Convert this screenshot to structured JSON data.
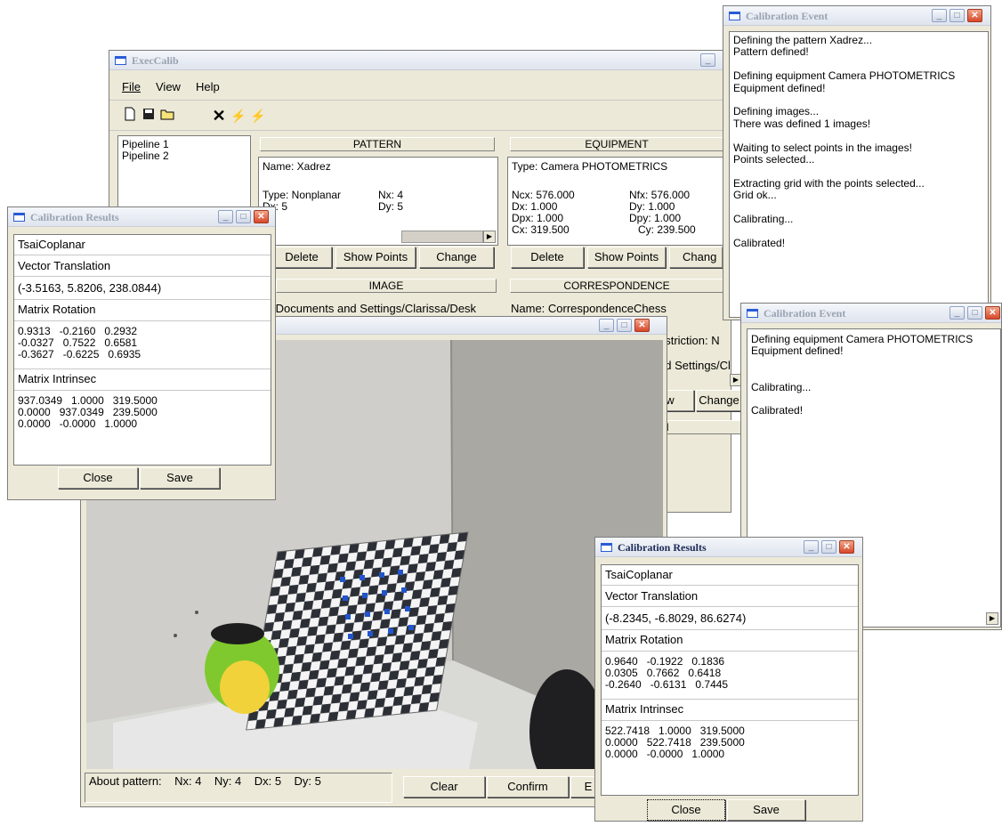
{
  "main": {
    "title": "ExecCalib",
    "menu": [
      "File",
      "View",
      "Help"
    ],
    "pipelines": [
      "Pipeline 1",
      "Pipeline 2"
    ],
    "pattern": {
      "header": "PATTERN",
      "name": "Name: Xadrez",
      "type": "Type: Nonplanar",
      "nx": "Nx: 4",
      "dx": "Dx: 5",
      "dy": "Dy: 5",
      "buttons": [
        "Delete",
        "Show Points",
        "Change"
      ]
    },
    "equipment": {
      "header": "EQUIPMENT",
      "type": "Type: Camera PHOTOMETRICS",
      "ncx": "Ncx: 576.000",
      "nfx": "Nfx: 576.000",
      "dx": "Dx: 1.000",
      "dy": "Dy: 1.000",
      "dpx": "Dpx: 1.000",
      "dpy": "Dpy: 1.000",
      "cx": "Cx: 319.500",
      "cy": "Cy: 239.500",
      "buttons": [
        "Delete",
        "Show Points",
        "Chang"
      ]
    },
    "image_header": "IMAGE",
    "image_path": "/Documents and Settings/Clarissa/Desk",
    "correspondence": {
      "header": "CORRESPONDENCE",
      "name": "Name: CorrespondenceChess",
      "restriction": "estriction: N",
      "path": "nd Settings/Cl",
      "buttons": [
        "ow",
        "Change"
      ],
      "header2": "N"
    }
  },
  "image_window": {
    "status": {
      "label": "About pattern:",
      "nx": "Nx: 4",
      "ny": "Ny: 4",
      "dx": "Dx: 5",
      "dy": "Dy: 5"
    },
    "buttons": [
      "Clear",
      "Confirm",
      "E"
    ]
  },
  "event1": {
    "title": "Calibration Event",
    "lines": [
      "Defining the pattern Xadrez...",
      "Pattern defined!",
      "",
      "Defining equipment Camera PHOTOMETRICS",
      "Equipment defined!",
      "",
      "Defining images...",
      "There was defined 1 images!",
      "",
      "Waiting to select points in the images!",
      "Points selected...",
      "",
      "Extracting grid with the points selected...",
      "Grid ok...",
      "",
      "Calibrating...",
      "",
      "Calibrated!"
    ]
  },
  "event2": {
    "title": "Calibration Event",
    "lines": [
      "Defining equipment Camera PHOTOMETRICS",
      "Equipment defined!",
      "",
      "",
      "Calibrating...",
      "",
      "Calibrated!"
    ]
  },
  "results1": {
    "title": "Calibration Results",
    "method": "TsaiCoplanar",
    "vt_label": "Vector Translation",
    "vt_value": "(-3.5163, 5.8206, 238.0844)",
    "mr_label": "Matrix Rotation",
    "mr_rows": [
      "0.9313   -0.2160   0.2932",
      "-0.0327   0.7522   0.6581",
      "-0.3627   -0.6225   0.6935"
    ],
    "mi_label": "Matrix Intrinsec",
    "mi_rows": [
      "937.0349   1.0000   319.5000",
      "0.0000   937.0349   239.5000",
      "0.0000   -0.0000   1.0000"
    ],
    "close": "Close",
    "save": "Save"
  },
  "results2": {
    "title": "Calibration Results",
    "method": "TsaiCoplanar",
    "vt_label": "Vector Translation",
    "vt_value": "(-8.2345, -6.8029, 86.6274)",
    "mr_label": "Matrix Rotation",
    "mr_rows": [
      "0.9640   -0.1922   0.1836",
      "0.0305   0.7662   0.6418",
      "-0.2640   -0.6131   0.7445"
    ],
    "mi_label": "Matrix Intrinsec",
    "mi_rows": [
      "522.7418   1.0000   319.5000",
      "0.0000   522.7418   239.5000",
      "0.0000   -0.0000   1.0000"
    ],
    "close": "Close",
    "save": "Save"
  },
  "colors": {
    "title_active": "#1b2a55",
    "title_inactive": "#9aa3b2",
    "window_bg": "#ece9d8",
    "grid_points": "#2255cc"
  }
}
